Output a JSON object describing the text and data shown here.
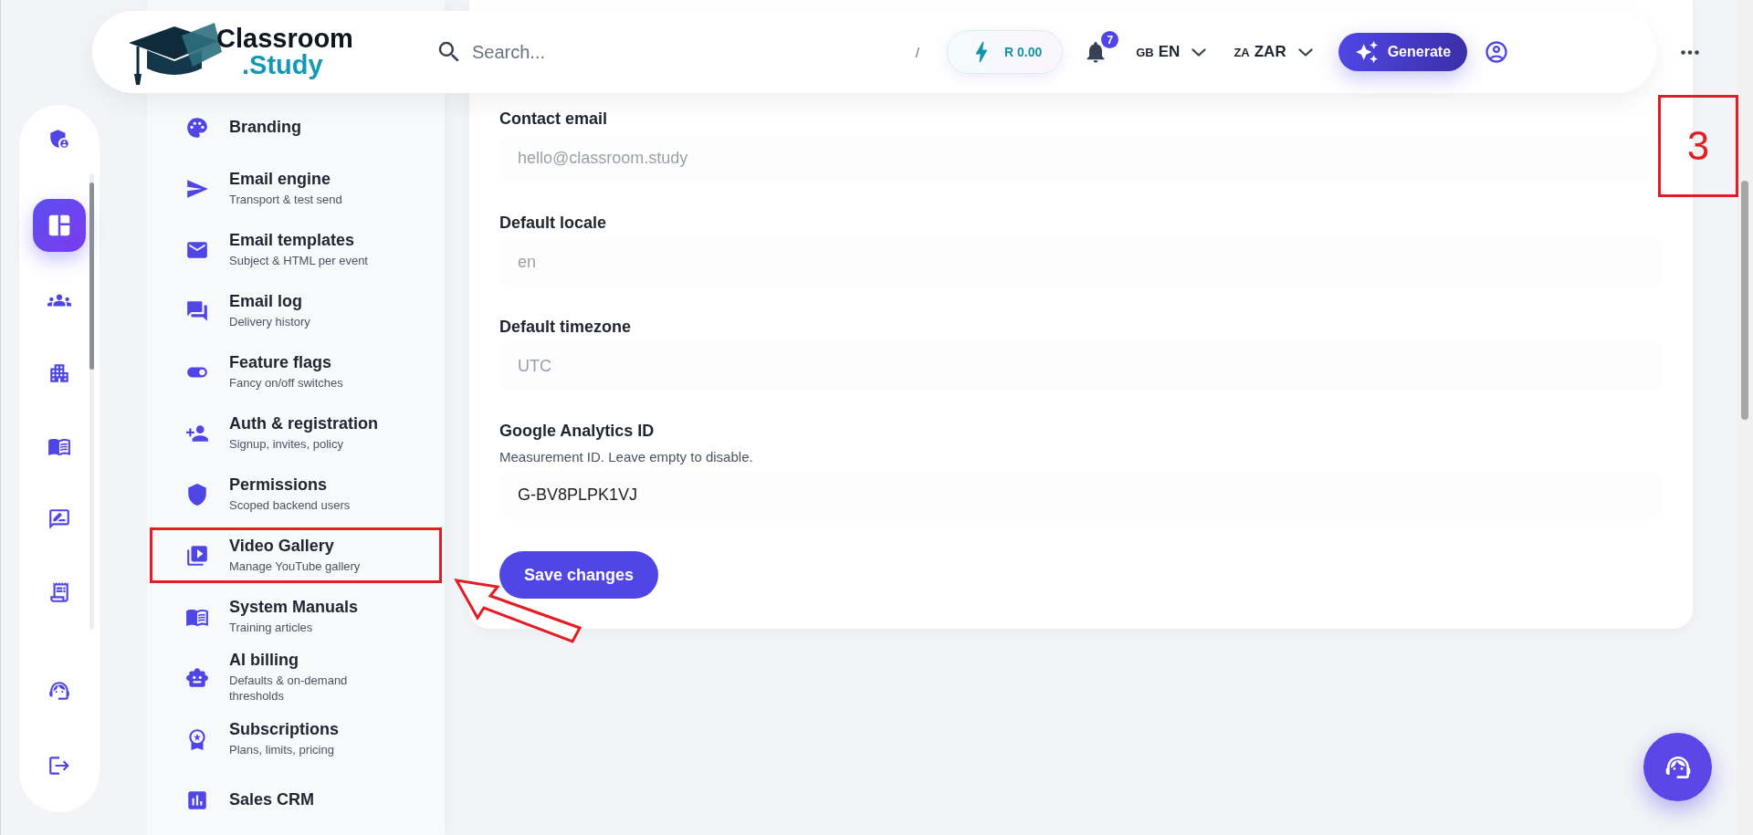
{
  "header": {
    "logo": {
      "word": "Classroom",
      "suffix": ".Study"
    },
    "search": {
      "placeholder": "Search...",
      "shortcut": "/"
    },
    "credit": {
      "amount": "R 0.00"
    },
    "notifications": {
      "count": "7"
    },
    "language": {
      "flag": "GB",
      "code": "EN"
    },
    "currency": {
      "flag": "ZA",
      "code": "ZAR"
    },
    "generate_button": "Generate"
  },
  "rail": {
    "items": [
      {
        "selected": false
      },
      {
        "selected": true
      },
      {
        "selected": false
      },
      {
        "selected": false
      },
      {
        "selected": false
      },
      {
        "selected": false
      },
      {
        "selected": false
      },
      {
        "selected": false
      },
      {
        "selected": false
      }
    ]
  },
  "settings_menu": {
    "items": [
      {
        "title": "Branding",
        "highlighted": false
      },
      {
        "title": "Email engine",
        "subtitle": "Transport & test send",
        "highlighted": false
      },
      {
        "title": "Email templates",
        "subtitle": "Subject & HTML per event",
        "highlighted": false
      },
      {
        "title": "Email log",
        "subtitle": "Delivery history",
        "highlighted": false
      },
      {
        "title": "Feature flags",
        "subtitle": "Fancy on/off switches",
        "highlighted": false
      },
      {
        "title": "Auth & registration",
        "subtitle": "Signup, invites, policy",
        "highlighted": false
      },
      {
        "title": "Permissions",
        "subtitle": "Scoped backend users",
        "highlighted": false
      },
      {
        "title": "Video Gallery",
        "subtitle": "Manage YouTube gallery",
        "highlighted": true
      },
      {
        "title": "System Manuals",
        "subtitle": "Training articles",
        "highlighted": false
      },
      {
        "title": "AI billing",
        "subtitle": "Defaults & on-demand thresholds",
        "highlighted": false
      },
      {
        "title": "Subscriptions",
        "subtitle": "Plans, limits, pricing",
        "highlighted": false
      },
      {
        "title": "Sales CRM",
        "highlighted": false
      }
    ]
  },
  "form": {
    "fields": [
      {
        "label": "Contact email",
        "placeholder": "hello@classroom.study"
      },
      {
        "label": "Default locale",
        "placeholder": "en"
      },
      {
        "label": "Default timezone",
        "placeholder": "UTC"
      },
      {
        "label": "Google Analytics ID",
        "help": "Measurement ID. Leave empty to disable.",
        "value": "G-BV8PLPK1VJ"
      }
    ],
    "save_button": "Save changes"
  },
  "annotation": {
    "step_label": "3"
  }
}
